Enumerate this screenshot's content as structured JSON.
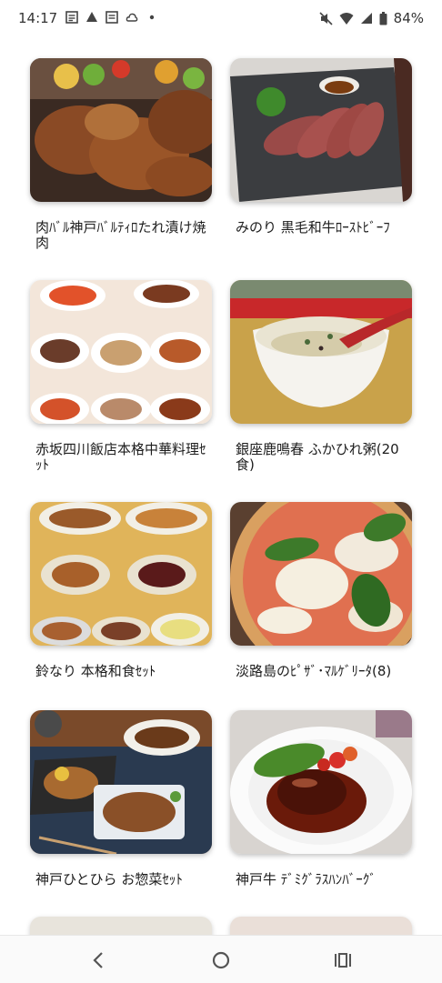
{
  "status_bar": {
    "time": "14:17",
    "battery": "84%",
    "notification_icons": [
      "news-icon",
      "drive-icon",
      "news-icon",
      "cloud-icon",
      "dot-icon"
    ],
    "system_icons": [
      "mute-icon",
      "wifi-icon",
      "signal-icon",
      "battery-icon"
    ]
  },
  "products": [
    {
      "title": "肉ﾊﾞﾙ神戸ﾊﾞﾙﾃｨﾛたれ漬け焼肉",
      "image": "grilled-meat-photo"
    },
    {
      "title": "みのり 黒毛和牛ﾛｰｽﾄﾋﾞｰﾌ",
      "image": "roast-beef-photo"
    },
    {
      "title": "赤坂四川飯店本格中華料理ｾｯﾄ",
      "image": "chinese-dishes-photo"
    },
    {
      "title": "銀座鹿鳴春 ふかひれ粥(20食)",
      "image": "shark-fin-porridge-photo"
    },
    {
      "title": "鈴なり 本格和食ｾｯﾄ",
      "image": "japanese-dishes-photo"
    },
    {
      "title": "淡路島のﾋﾟｻﾞ･ﾏﾙｹﾞﾘｰﾀ(8)",
      "image": "margherita-pizza-photo"
    },
    {
      "title": "神戸ひとひら お惣菜ｾｯﾄ",
      "image": "side-dishes-photo"
    },
    {
      "title": "神戸牛 ﾃﾞﾐｸﾞﾗｽﾊﾝﾊﾞｰｸﾞ",
      "image": "hamburg-steak-photo"
    }
  ],
  "nav": {
    "back": "back-icon",
    "home": "home-icon",
    "recents": "recents-icon"
  }
}
